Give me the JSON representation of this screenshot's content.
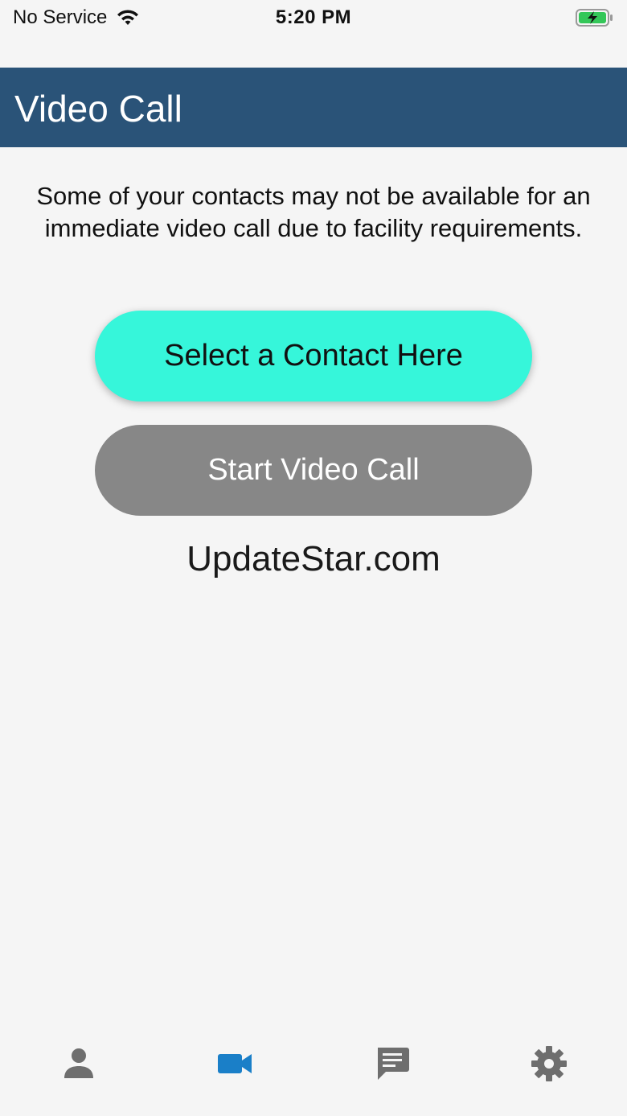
{
  "status_bar": {
    "carrier": "No Service",
    "time": "5:20 PM",
    "wifi_icon": "wifi-icon",
    "battery_icon": "battery-charging-icon",
    "battery_color": "#34c759"
  },
  "nav": {
    "title": "Video Call",
    "background": "#2a5378"
  },
  "main": {
    "notice": "Some of your contacts may not be available for an immediate video call due to facility requirements.",
    "select_contact_label": "Select a Contact Here",
    "select_contact_color": "#36f6da",
    "start_call_label": "Start Video Call",
    "start_call_color": "#878787",
    "watermark": "UpdateStar.com"
  },
  "tab_bar": {
    "active_color": "#1a7fc8",
    "inactive_color": "#6e6e6e",
    "tabs": [
      {
        "icon": "person-icon",
        "active": false
      },
      {
        "icon": "video-camera-icon",
        "active": true
      },
      {
        "icon": "chat-message-icon",
        "active": false
      },
      {
        "icon": "gear-icon",
        "active": false
      }
    ]
  }
}
